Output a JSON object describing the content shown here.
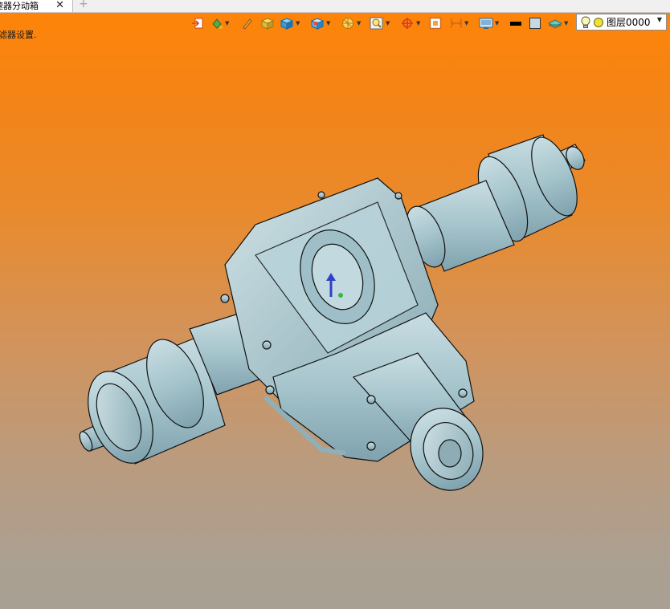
{
  "tabs": {
    "active_title": "速器分动箱",
    "close_glyph": "✕",
    "add_glyph": "+"
  },
  "status": {
    "message": "滤器设置."
  },
  "toolbar": {
    "icons": [
      "exit-sketch-icon",
      "paint-bucket-icon",
      "pencil-icon",
      "shaded-box-icon",
      "view-cube-icon",
      "view-orientation-icon",
      "section-view-icon",
      "zoom-fit-icon",
      "snap-target-icon",
      "frame-icon",
      "dimension-icon",
      "display-settings-icon",
      "line-color-icon",
      "face-color-icon",
      "layer-icon"
    ],
    "line_color": "#000000",
    "face_color": "#c6d9e4"
  },
  "layer": {
    "name": "图层0000",
    "caret": "▼"
  },
  "viewport": {
    "background_top": "#ff8406",
    "background_bottom": "#a8a093",
    "model_color": "#a5c4cc",
    "edge_color": "#111111"
  }
}
